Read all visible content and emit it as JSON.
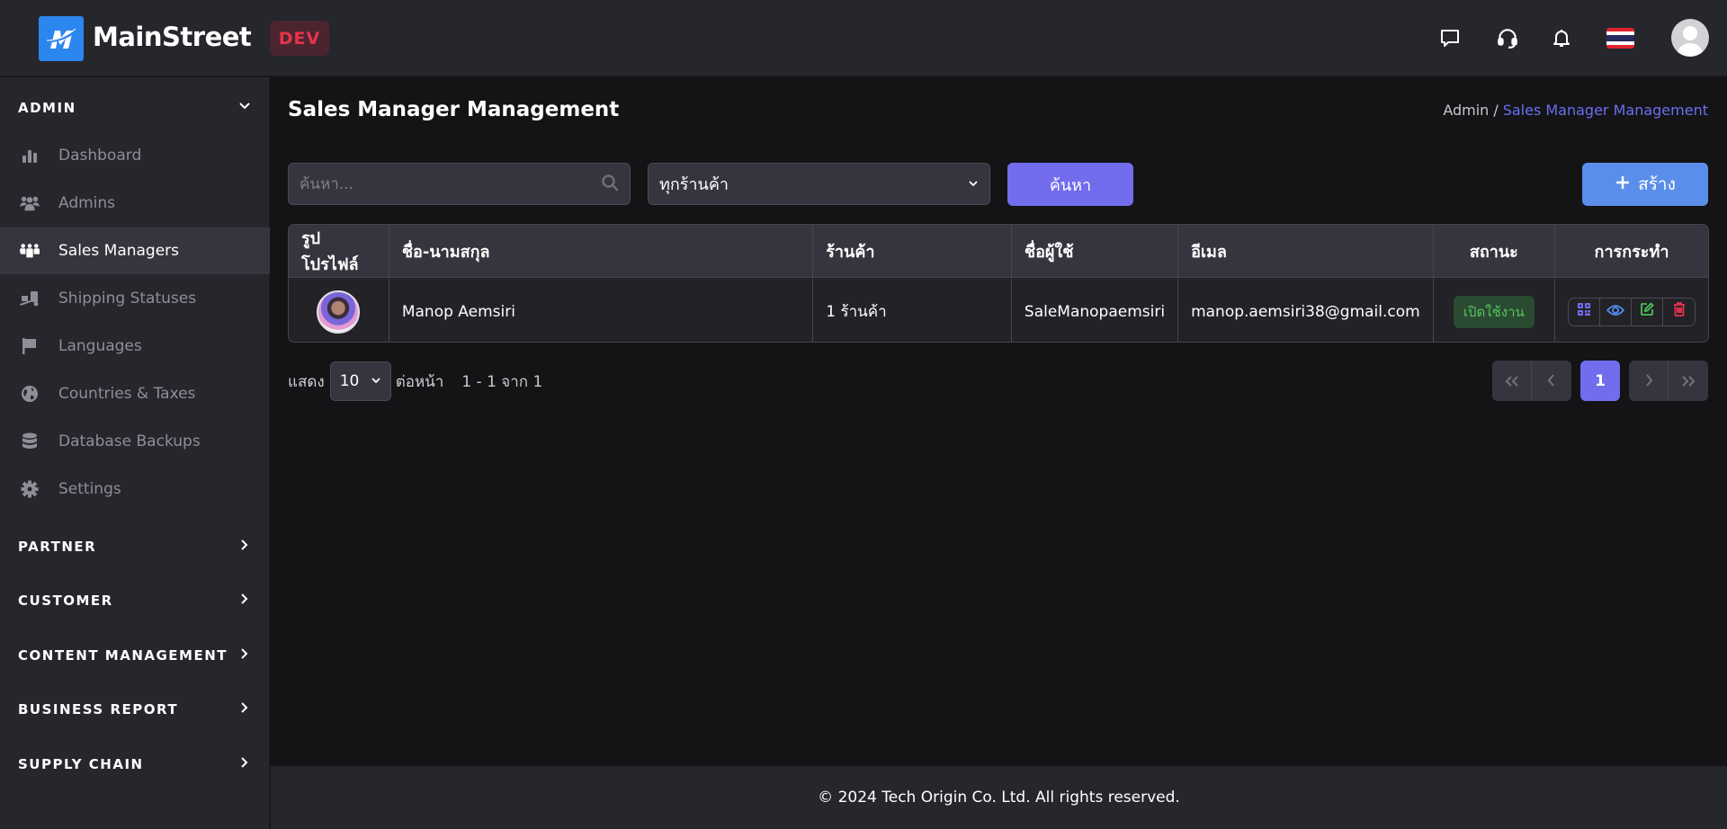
{
  "header": {
    "brand": "MainStreet",
    "env_badge": "DEV",
    "icons": [
      "chat-icon",
      "headset-icon",
      "bell-icon",
      "thai-flag-icon",
      "user-avatar-icon"
    ]
  },
  "sidebar": {
    "admin_section": {
      "label": "ADMIN",
      "expanded": true,
      "items": [
        {
          "label": "Dashboard",
          "icon": "chart-bar-icon",
          "active": false
        },
        {
          "label": "Admins",
          "icon": "users-icon",
          "active": false
        },
        {
          "label": "Sales Managers",
          "icon": "people-group-icon",
          "active": true
        },
        {
          "label": "Shipping Statuses",
          "icon": "truck-ramp-icon",
          "active": false
        },
        {
          "label": "Languages",
          "icon": "flag-icon",
          "active": false
        },
        {
          "label": "Countries & Taxes",
          "icon": "globe-icon",
          "active": false
        },
        {
          "label": "Database Backups",
          "icon": "database-icon",
          "active": false
        },
        {
          "label": "Settings",
          "icon": "gear-icon",
          "active": false
        }
      ]
    },
    "sections": [
      {
        "label": "PARTNER"
      },
      {
        "label": "CUSTOMER"
      },
      {
        "label": "CONTENT MANAGEMENT"
      },
      {
        "label": "BUSINESS REPORT"
      },
      {
        "label": "SUPPLY CHAIN"
      }
    ]
  },
  "main": {
    "title": "Sales Manager Management",
    "breadcrumb": {
      "root": "Admin",
      "separator": "/",
      "current": "Sales Manager Management"
    },
    "search": {
      "placeholder": "ค้นหา...",
      "value": ""
    },
    "store_filter": {
      "selected": "ทุกร้านค้า"
    },
    "search_button": "ค้นหา",
    "create_button": "สร้าง",
    "table": {
      "columns": [
        "รูปโปรไฟล์",
        "ชื่อ-นามสกุล",
        "ร้านค้า",
        "ชื่อผู้ใช้",
        "อีเมล",
        "สถานะ",
        "การกระทำ"
      ],
      "rows": [
        {
          "full_name": "Manop Aemsiri",
          "stores": "1 ร้านค้า",
          "username": "SaleManopaemsiri",
          "email": "manop.aemsiri38@gmail.com",
          "status": "เปิดใช้งาน"
        }
      ]
    },
    "pagination": {
      "show_label": "แสดง",
      "per_page": "10",
      "per_page_label": "ต่อหน้า",
      "range_text": "1 - 1 จาก 1",
      "current_page": "1"
    }
  },
  "footer": {
    "text": "© 2024 Tech Origin Co. Ltd. All rights reserved."
  },
  "colors": {
    "accent": "#716ded",
    "create": "#5b8eea",
    "logo": "#2b86ee",
    "dev_badge": "#e8334d",
    "status_active": "#54c45f",
    "action_qr": "#716ded",
    "action_view": "#4f8ef0",
    "action_edit": "#4cc154",
    "action_delete": "#e8334d"
  }
}
